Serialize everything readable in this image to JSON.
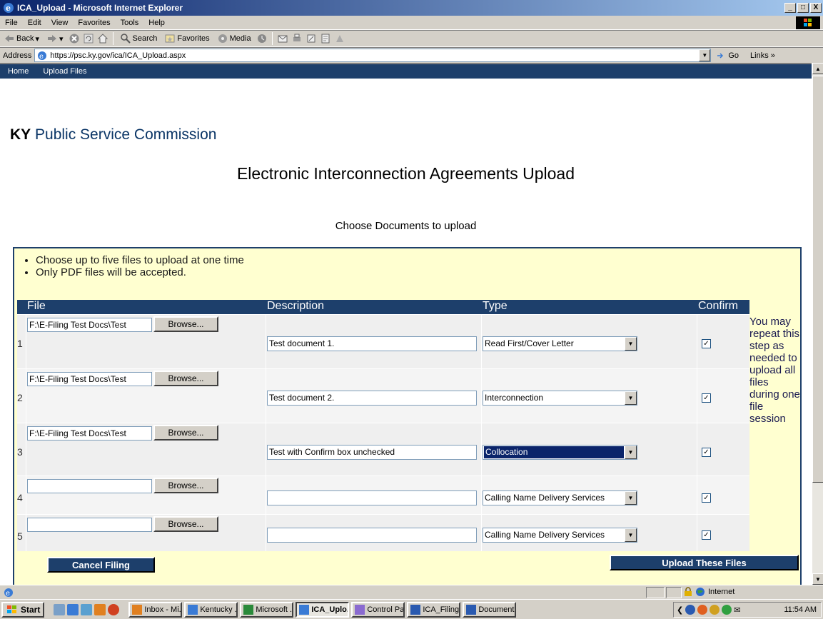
{
  "window": {
    "title": "ICA_Upload - Microsoft Internet Explorer",
    "minimize": "_",
    "maximize": "□",
    "close": "X"
  },
  "menu": [
    "File",
    "Edit",
    "View",
    "Favorites",
    "Tools",
    "Help"
  ],
  "toolbar": {
    "back": "Back",
    "search": "Search",
    "favorites": "Favorites",
    "media": "Media"
  },
  "address": {
    "label": "Address",
    "url": "https://psc.ky.gov/ica/ICA_Upload.aspx",
    "go": "Go",
    "links": "Links"
  },
  "nav": [
    "Home",
    "Upload Files"
  ],
  "brand": {
    "state": "KY",
    "name": " Public Service Commission"
  },
  "page": {
    "heading": "Electronic Interconnection Agreements Upload",
    "subheading": "Choose Documents to upload",
    "instructions": [
      "Choose up to five files to upload at one time",
      "Only PDF files will be accepted."
    ],
    "columns": {
      "file": "File",
      "description": "Description",
      "type": "Type",
      "confirm": "Confirm"
    },
    "browse_label": "Browse...",
    "rows": [
      {
        "num": "1",
        "file": "F:\\E-Filing Test Docs\\Test",
        "description": "Test document 1.",
        "type": "Read First/Cover Letter",
        "confirm": "✓"
      },
      {
        "num": "2",
        "file": "F:\\E-Filing Test Docs\\Test",
        "description": "Test document 2.",
        "type": "Interconnection",
        "confirm": "✓"
      },
      {
        "num": "3",
        "file": "F:\\E-Filing Test Docs\\Test",
        "description": "Test with Confirm box unchecked",
        "type": "Collocation",
        "confirm": "✓"
      },
      {
        "num": "4",
        "file": "",
        "description": "",
        "type": "Calling Name Delivery Services",
        "confirm": "✓"
      },
      {
        "num": "5",
        "file": "",
        "description": "",
        "type": "Calling Name Delivery Services",
        "confirm": "✓"
      }
    ],
    "side_note": "You may repeat this step as needed to upload all files during one file session",
    "cancel_button": "Cancel Filing",
    "upload_button": "Upload These Files"
  },
  "status": {
    "zone": "Internet"
  },
  "taskbar": {
    "start": "Start",
    "tasks": [
      {
        "label": "Inbox - Mi...",
        "active": false
      },
      {
        "label": "Kentucky ...",
        "active": false
      },
      {
        "label": "Microsoft ...",
        "active": false
      },
      {
        "label": "ICA_Uplo...",
        "active": true
      },
      {
        "label": "Control Pa...",
        "active": false
      },
      {
        "label": "ICA_Filing...",
        "active": false
      },
      {
        "label": "Document...",
        "active": false
      }
    ],
    "clock": "11:54 AM"
  },
  "colors": {
    "nav": "#1d3f6b",
    "panel": "#ffffd0",
    "selection": "#0a246a"
  }
}
